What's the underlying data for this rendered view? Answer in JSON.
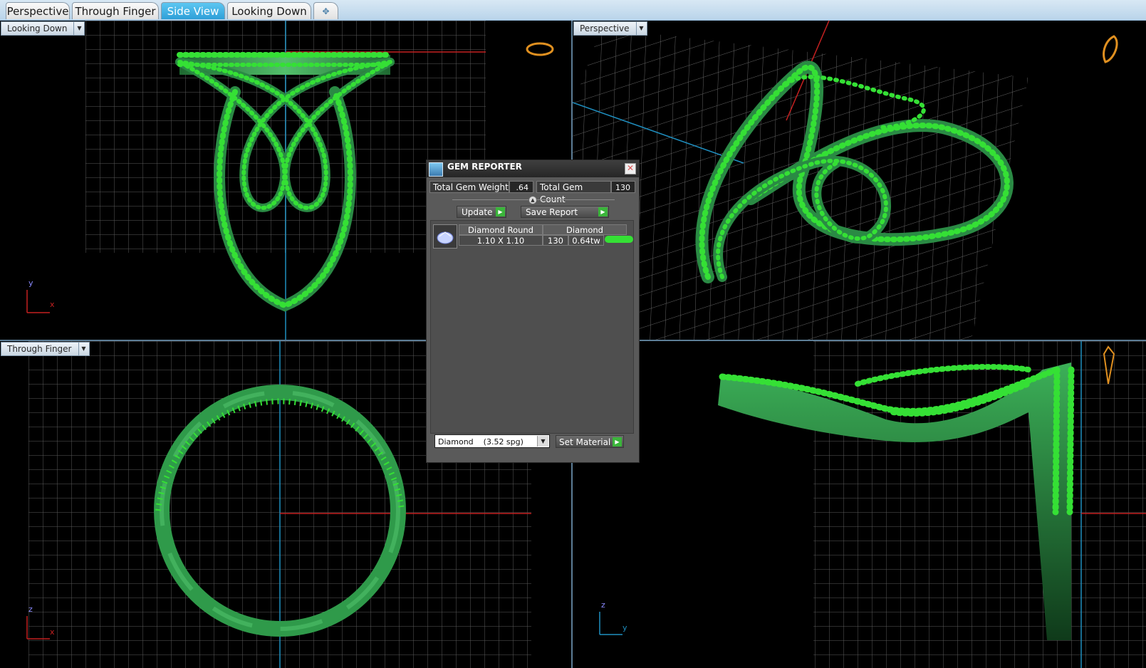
{
  "tabs": [
    {
      "label": "Perspective",
      "active": false
    },
    {
      "label": "Through Finger",
      "active": false
    },
    {
      "label": "Side View",
      "active": true
    },
    {
      "label": "Looking Down",
      "active": false
    }
  ],
  "add_tab_glyph": "✥",
  "viewports": {
    "top_left": {
      "label": "Looking Down",
      "axis_a": "y",
      "axis_b": "x"
    },
    "top_right": {
      "label": "Perspective"
    },
    "bottom_left": {
      "label": "Through Finger",
      "axis_a": "z",
      "axis_b": "x"
    },
    "bottom_right": {
      "axis_a": "z",
      "axis_b": "y"
    }
  },
  "gem_reporter": {
    "title": "GEM REPORTER",
    "total_weight_label": "Total Gem Weight",
    "total_weight_value": ".64",
    "total_count_label": "Total Gem Count",
    "total_count_value": "130",
    "update_label": "Update",
    "save_report_label": "Save Report",
    "gems": [
      {
        "shape": "Diamond Round",
        "size": "1.10 X 1.10",
        "material": "Diamond",
        "count": "130",
        "weight": "0.64tw"
      }
    ],
    "material_select": "Diamond    (3.52 spg)",
    "set_material_label": "Set Material"
  },
  "colors": {
    "gem_green": "#35e035",
    "metal_green": "#2f9a4a",
    "grid": "#5a5a5a",
    "axis_red": "#c42020",
    "axis_blue": "#1f8fc0",
    "tab_active": "#2e9fd8"
  },
  "icons": [
    "close-icon",
    "play-arrow-icon",
    "dropdown-arrow-icon",
    "diamond-icon",
    "ring-thumbnail-icon"
  ]
}
